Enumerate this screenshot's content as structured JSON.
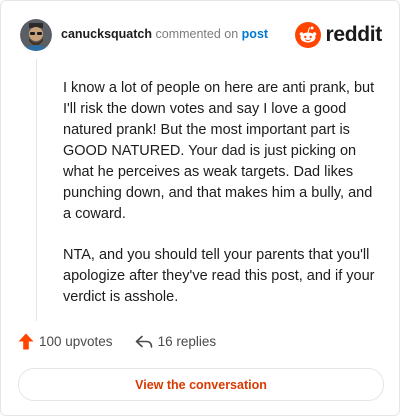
{
  "header": {
    "username": "canucksquatch",
    "action_text": "commented on",
    "post_link": "post",
    "brand": "reddit"
  },
  "comment": {
    "paragraphs": [
      "I know a lot of people on here are anti prank, but I'll risk the down votes and say I love a good natured prank! But the most important part is GOOD NATURED. Your dad is just picking on what he perceives as weak targets. Dad likes punching down, and that makes him a bully, and a coward.",
      "NTA, and you should tell your parents that you'll apologize after they've read this post, and if your verdict is asshole."
    ]
  },
  "stats": {
    "upvotes": "100 upvotes",
    "replies": "16 replies"
  },
  "actions": {
    "view_conversation": "View the conversation"
  },
  "colors": {
    "accent_orange": "#ff4500",
    "link_blue": "#0079d3",
    "button_text": "#d93a00"
  }
}
